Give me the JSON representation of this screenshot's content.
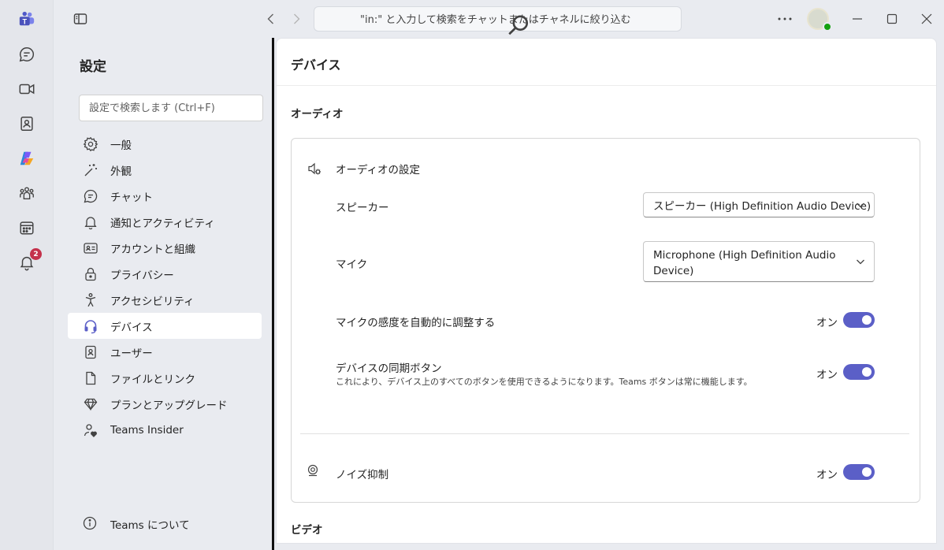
{
  "rail": {
    "items": [
      {
        "name": "teams-logo-icon"
      },
      {
        "name": "chat-icon"
      },
      {
        "name": "video-icon"
      },
      {
        "name": "contacts-icon"
      },
      {
        "name": "copilot-icon"
      },
      {
        "name": "communities-icon"
      },
      {
        "name": "calendar-icon"
      },
      {
        "name": "activity-bell-icon"
      }
    ],
    "activity_badge": "2"
  },
  "topbar": {
    "search_placeholder": "\"in:\" と入力して検索をチャットまたはチャネルに絞り込む"
  },
  "settings": {
    "title": "設定",
    "search_placeholder": "設定で検索します (Ctrl+F)",
    "nav": [
      {
        "label": "一般",
        "icon": "gear-icon"
      },
      {
        "label": "外観",
        "icon": "magic-wand-icon"
      },
      {
        "label": "チャット",
        "icon": "chat-icon"
      },
      {
        "label": "通知とアクティビティ",
        "icon": "bell-icon"
      },
      {
        "label": "アカウントと組織",
        "icon": "id-card-icon"
      },
      {
        "label": "プライバシー",
        "icon": "lock-icon"
      },
      {
        "label": "アクセシビリティ",
        "icon": "accessibility-icon"
      },
      {
        "label": "デバイス",
        "icon": "headset-icon",
        "active": true
      },
      {
        "label": "ユーザー",
        "icon": "contact-card-icon"
      },
      {
        "label": "ファイルとリンク",
        "icon": "document-icon"
      },
      {
        "label": "プランとアップグレード",
        "icon": "diamond-icon"
      },
      {
        "label": "Teams Insider",
        "icon": "person-heart-icon"
      }
    ],
    "about": "Teams について"
  },
  "main": {
    "title": "デバイス",
    "audio_section": "オーディオ",
    "audio_settings": "オーディオの設定",
    "speaker_label": "スピーカー",
    "speaker_value": "スピーカー (High Definition Audio Device)",
    "mic_label": "マイク",
    "mic_value": "Microphone (High Definition Audio Device)",
    "auto_adjust_label": "マイクの感度を自動的に調整する",
    "auto_adjust_state": "オン",
    "sync_label": "デバイスの同期ボタン",
    "sync_desc": "これにより、デバイス上のすべてのボタンを使用できるようになります。Teams ボタンは常に機能します。",
    "sync_state": "オン",
    "noise_label": "ノイズ抑制",
    "noise_state": "オン",
    "video_section": "ビデオ"
  },
  "colors": {
    "accent": "#5b5fc7",
    "badge": "#c4314b",
    "presence": "#13a10e"
  }
}
